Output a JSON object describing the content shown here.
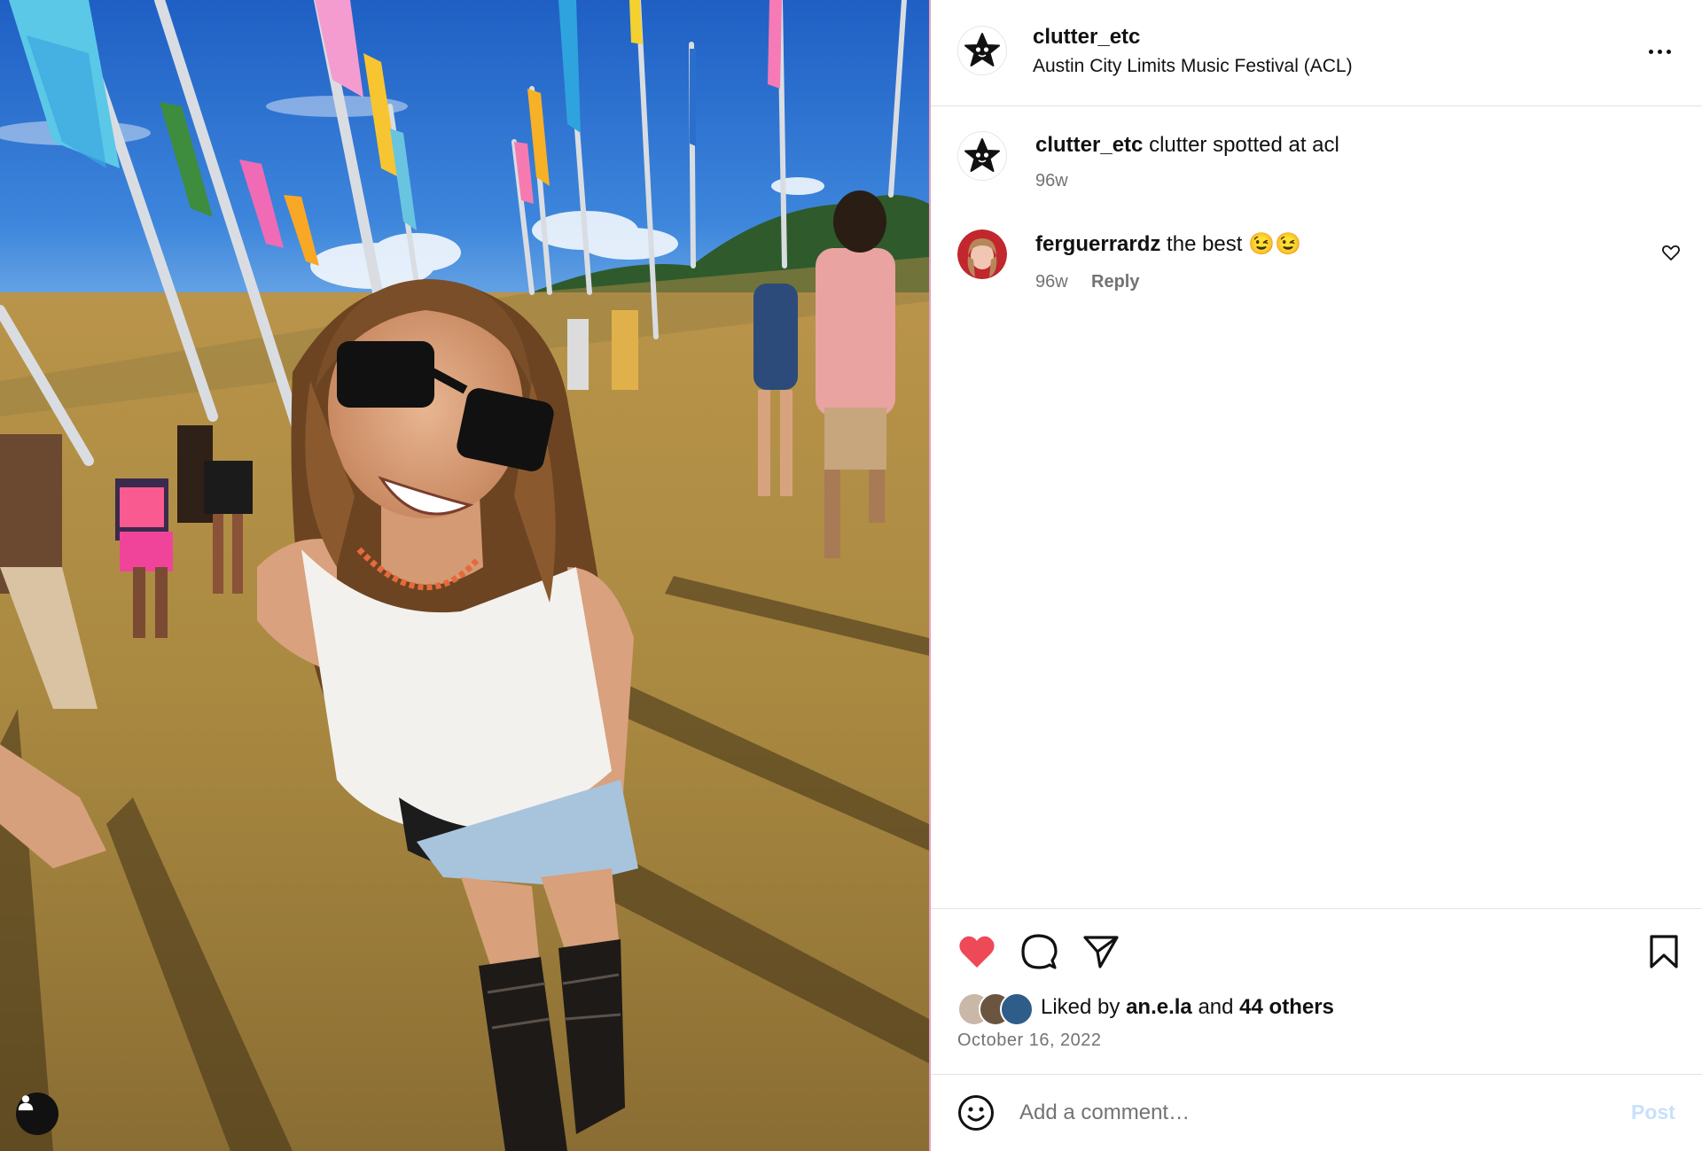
{
  "post": {
    "username": "clutter_etc",
    "location": "Austin City Limits Music Festival (ACL)",
    "caption": "clutter spotted at acl",
    "caption_time": "96w"
  },
  "comments": [
    {
      "username": "ferguerrardz",
      "text": "the best 😉😉",
      "time": "96w",
      "reply_label": "Reply"
    }
  ],
  "likes": {
    "prefix": "Liked by ",
    "first_liker": "an.e.la",
    "joiner": " and ",
    "others": "44 others"
  },
  "date": "October 16, 2022",
  "comment_box": {
    "placeholder": "Add a comment…",
    "post_label": "Post"
  },
  "colors": {
    "heart": "#ed4956",
    "post_button_disabled": "#c7e1fb",
    "muted_text": "#737373",
    "divider_pink": "#e4a3c3"
  },
  "icons": [
    "heart-icon",
    "comment-icon",
    "share-icon",
    "bookmark-icon",
    "more-icon",
    "emoji-icon",
    "user-tag-icon"
  ]
}
